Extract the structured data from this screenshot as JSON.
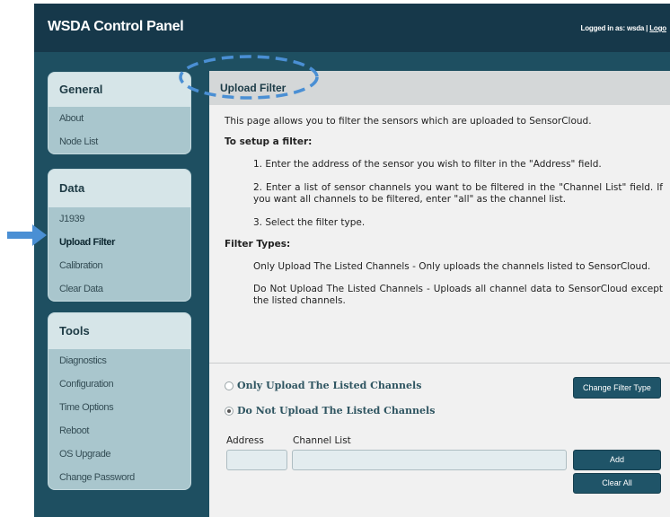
{
  "app": {
    "title": "WSDA Control Panel",
    "login_text": "Logged in as: wsda | ",
    "logout_label": "Logo"
  },
  "sidebar": {
    "sections": [
      {
        "title": "General",
        "items": [
          "About",
          "Node List"
        ]
      },
      {
        "title": "Data",
        "items": [
          "J1939",
          "Upload Filter",
          "Calibration",
          "Clear Data"
        ]
      },
      {
        "title": "Tools",
        "items": [
          "Diagnostics",
          "Configuration",
          "Time Options",
          "Reboot",
          "OS Upgrade",
          "Change Password"
        ]
      }
    ],
    "active_item": "Upload Filter"
  },
  "content": {
    "title": "Upload Filter",
    "intro": "This page allows you to filter the sensors which are uploaded to SensorCloud.",
    "setup_heading": "To setup a filter:",
    "steps": [
      "1. Enter the address of the sensor you wish to filter in the \"Address\" field.",
      "2. Enter a list of sensor channels you want to be filtered in the \"Channel List\" field. If you want all channels to be filtered, enter \"all\" as the channel list.",
      "3. Select the filter type."
    ],
    "types_heading": "Filter Types:",
    "filter_types": [
      "Only Upload The Listed Channels - Only uploads the channels listed to SensorCloud.",
      "Do Not Upload The Listed Channels - Uploads all channel data to SensorCloud except the listed channels."
    ]
  },
  "form": {
    "radio_options": [
      "Only Upload The Listed Channels",
      "Do Not Upload The Listed Channels"
    ],
    "selected_option": "Do Not Upload The Listed Channels",
    "change_filter_label": "Change Filter Type",
    "address_label": "Address",
    "channel_list_label": "Channel List",
    "address_value": "",
    "channel_list_value": "",
    "add_label": "Add",
    "clear_all_label": "Clear All"
  },
  "colors": {
    "header_bg": "#16384a",
    "page_bg": "#1e4f61",
    "sidebar_box": "#a9c6cd",
    "button": "#1f5468",
    "annotation_blue": "#4a8fd4"
  },
  "icons": [
    "pointer-arrow-icon",
    "dashed-highlight-ellipse"
  ]
}
